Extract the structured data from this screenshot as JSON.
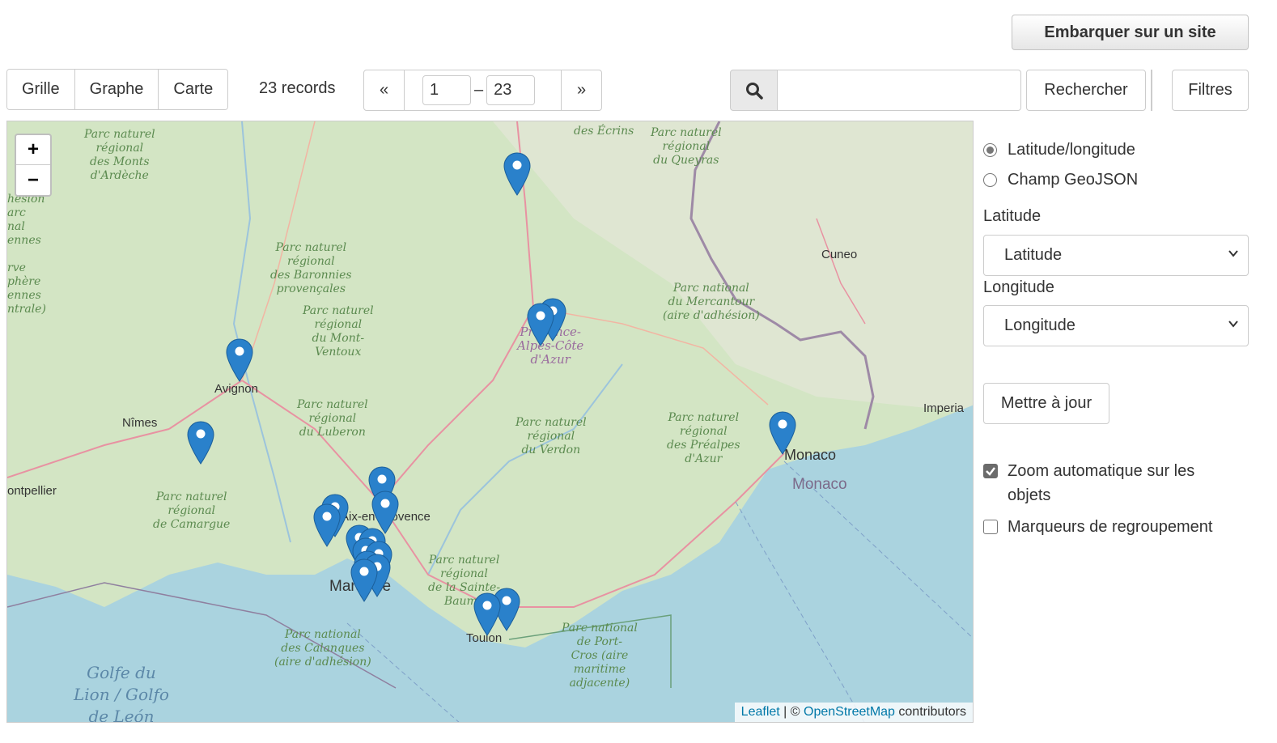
{
  "toolbar": {
    "embed_label": "Embarquer sur un site",
    "views": [
      {
        "label": "Grille"
      },
      {
        "label": "Graphe"
      },
      {
        "label": "Carte"
      }
    ],
    "records_text": "23 records",
    "pager": {
      "prev": "«",
      "next": "»",
      "from": "1",
      "dash": "–",
      "to": "23"
    },
    "search": {
      "value": "",
      "button_label": "Rechercher"
    },
    "filters_label": "Filtres"
  },
  "map": {
    "zoom_in": "+",
    "zoom_out": "−",
    "attribution": {
      "leaflet": "Leaflet",
      "separator": " | © ",
      "osm": "OpenStreetMap",
      "suffix": " contributors"
    },
    "labels": {
      "ardeche": "Parc naturel\nrégional\ndes Monts\nd'Ardèche",
      "ecrins": "des Écrins",
      "queyras": "Parc naturel\nrégional\ndu Queyras",
      "baronnies": "Parc naturel\nrégional\ndes Baronnies\nprovençales",
      "ventoux": "Parc naturel\nrégional\ndu Mont-\nVentoux",
      "mercantour": "Parc national\ndu Mercantour\n(aire d'adhésion)",
      "luberon": "Parc naturel\nrégional\ndu Luberon",
      "verdon": "Parc naturel\nrégional\ndu Verdon",
      "prealpes": "Parc naturel\nrégional\ndes Préalpes\nd'Azur",
      "camargue": "Parc naturel\nrégional\nde Camargue",
      "sainte_baume": "Parc naturel\nrégional\nde la Sainte-\nBaume",
      "calanques": "Parc national\ndes Calanques\n(aire d'adhésion)",
      "portcros": "Parc national\nde Port-\nCros (aire\nmaritime\nadjacente)",
      "cevennes": "hésion\narc\nnal\nennes\n\nrve\nphère\nennes\nntrale)",
      "paca": "Provence-\nAlpes-Côte\nd'Azur"
    },
    "cities": {
      "cuneo": "Cuneo",
      "avignon": "Avignon",
      "nimes": "Nîmes",
      "imperia": "Imperia",
      "monaco_city": "Monaco",
      "monaco_country": "Monaco",
      "montpellier": "ontpellier",
      "aix": "Aix-en-Provence",
      "marseille": "Marseille",
      "toulon": "Toulon"
    },
    "sea": "Golfe du\nLion / Golfo\nde León",
    "marker_color": "#2a81cb"
  },
  "panel": {
    "radio_latlng": "Latitude/longitude",
    "radio_geojson": "Champ GeoJSON",
    "latitude_label": "Latitude",
    "latitude_value": "Latitude",
    "longitude_label": "Longitude",
    "longitude_value": "Longitude",
    "update_label": "Mettre à jour",
    "auto_zoom_label": "Zoom automatique sur les objets",
    "cluster_label": "Marqueurs de regroupement"
  }
}
